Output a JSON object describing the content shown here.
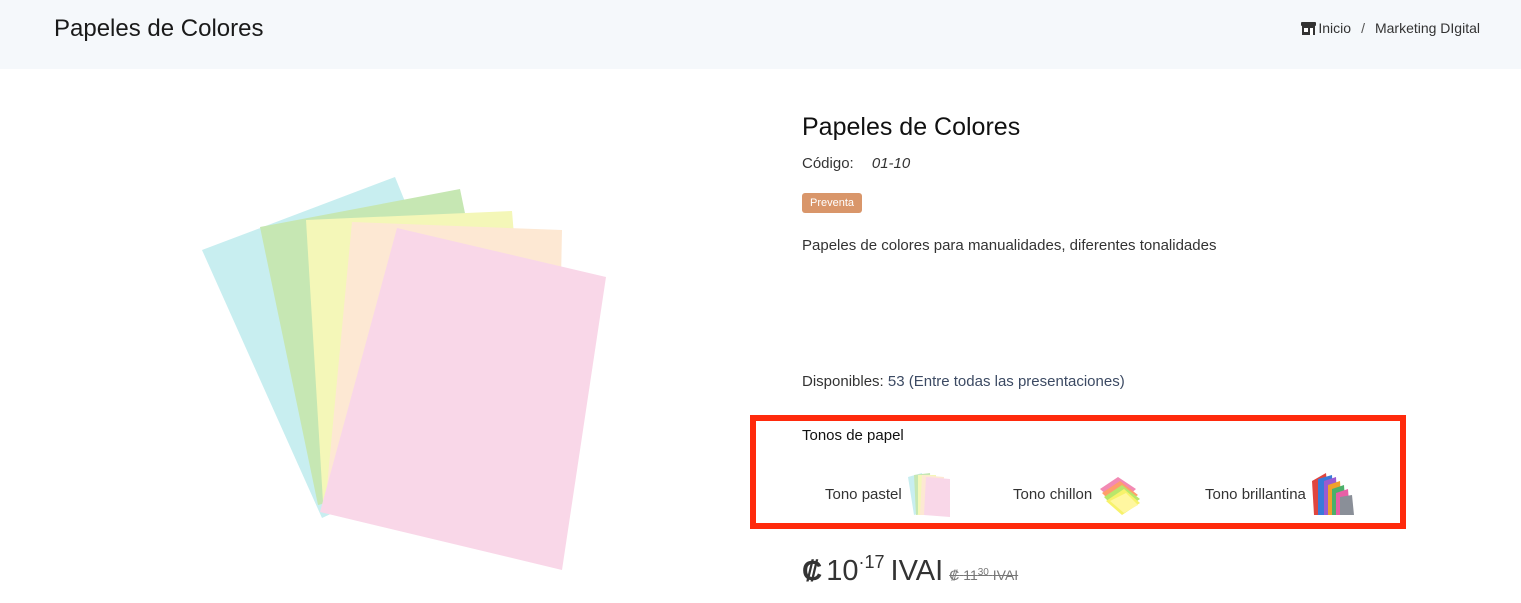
{
  "header": {
    "title": "Papeles de Colores",
    "breadcrumb": {
      "home": "Inicio",
      "separator": "/",
      "current": "Marketing DIgital"
    }
  },
  "product": {
    "title": "Papeles de Colores",
    "code_label": "Código:",
    "code_value": "01-10",
    "badge": "Preventa",
    "description": "Papeles de colores para manualidades, diferentes tonalidades",
    "stock_label": "Disponibles:",
    "stock_value": "53 (Entre todas las presentaciones)"
  },
  "tones": {
    "label": "Tonos de papel",
    "options": [
      {
        "label": "Tono pastel"
      },
      {
        "label": "Tono chillon"
      },
      {
        "label": "Tono brillantina"
      }
    ]
  },
  "price": {
    "currency": "₡",
    "integer": "10",
    "decimal": "17",
    "tax": "IVAI",
    "old_integer": "11",
    "old_decimal": "30",
    "old_tax": "IVAI"
  },
  "colors": {
    "header_bg": "#f5f8fb",
    "badge": "#d9966a",
    "highlight_border": "#ff2a0c"
  }
}
